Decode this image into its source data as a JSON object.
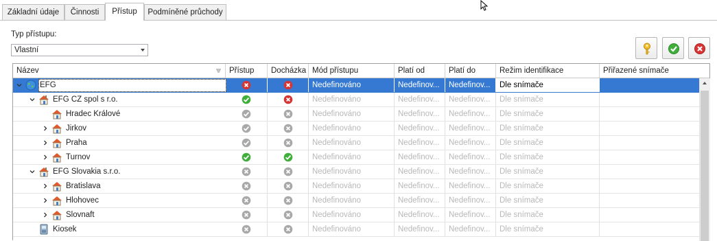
{
  "tabs": [
    {
      "label": "Základní údaje",
      "active": false
    },
    {
      "label": "Činnosti",
      "active": false
    },
    {
      "label": "Přístup",
      "active": true
    },
    {
      "label": "Podmíněné průchody",
      "active": false
    }
  ],
  "access_type": {
    "label": "Typ přístupu:",
    "value": "Vlastní"
  },
  "toolbar": {
    "buttons": [
      "key-icon",
      "confirm-icon",
      "cancel-icon"
    ]
  },
  "columns": [
    "Název",
    "Přístup",
    "Docházka",
    "Mód přístupu",
    "Platí od",
    "Platí do",
    "Režim identifikace",
    "Přiřazené snímače"
  ],
  "rows": [
    {
      "name": "EFG",
      "expand": "open",
      "icon": "globe-icon",
      "access": "denied",
      "attendance": "denied",
      "mode": "Nedefinováno",
      "from": "Nedefinov...",
      "to": "Nedefinov...",
      "ident": "Dle snímače",
      "selected": true,
      "dimmed": false
    },
    {
      "name": "EFG CZ spol s r.o.",
      "expand": "open",
      "icon": "company-icon",
      "access": "granted",
      "attendance": "denied",
      "mode": "Nedefinováno",
      "from": "Nedefinov...",
      "to": "Nedefinov...",
      "ident": "Dle snímače",
      "selected": false,
      "dimmed": true
    },
    {
      "name": "Hradec Králové",
      "expand": "none",
      "icon": "branch-icon",
      "access": "granted-gray",
      "attendance": "denied-gray",
      "mode": "Nedefinováno",
      "from": "Nedefinov...",
      "to": "Nedefinov...",
      "ident": "Dle snímače",
      "selected": false,
      "dimmed": true
    },
    {
      "name": "Jirkov",
      "expand": "closed",
      "icon": "branch-icon",
      "access": "granted-gray",
      "attendance": "denied-gray",
      "mode": "Nedefinováno",
      "from": "Nedefinov...",
      "to": "Nedefinov...",
      "ident": "Dle snímače",
      "selected": false,
      "dimmed": true
    },
    {
      "name": "Praha",
      "expand": "closed",
      "icon": "branch-icon",
      "access": "granted-gray",
      "attendance": "denied-gray",
      "mode": "Nedefinováno",
      "from": "Nedefinov...",
      "to": "Nedefinov...",
      "ident": "Dle snímače",
      "selected": false,
      "dimmed": true
    },
    {
      "name": "Turnov",
      "expand": "closed",
      "icon": "branch-icon",
      "access": "granted",
      "attendance": "granted",
      "mode": "Nedefinováno",
      "from": "Nedefinov...",
      "to": "Nedefinov...",
      "ident": "Dle snímače",
      "selected": false,
      "dimmed": true
    },
    {
      "name": "EFG Slovakia s.r.o.",
      "expand": "open",
      "icon": "company-icon",
      "access": "denied-gray",
      "attendance": "denied-gray",
      "mode": "Nedefinováno",
      "from": "Nedefinov...",
      "to": "Nedefinov...",
      "ident": "Dle snímače",
      "selected": false,
      "dimmed": true
    },
    {
      "name": "Bratislava",
      "expand": "closed",
      "icon": "branch-icon",
      "access": "denied-gray",
      "attendance": "denied-gray",
      "mode": "Nedefinováno",
      "from": "Nedefinov...",
      "to": "Nedefinov...",
      "ident": "Dle snímače",
      "selected": false,
      "dimmed": true
    },
    {
      "name": "Hlohovec",
      "expand": "closed",
      "icon": "branch-icon",
      "access": "denied-gray",
      "attendance": "denied-gray",
      "mode": "Nedefinováno",
      "from": "Nedefinov...",
      "to": "Nedefinov...",
      "ident": "Dle snímače",
      "selected": false,
      "dimmed": true
    },
    {
      "name": "Slovnaft",
      "expand": "closed",
      "icon": "branch-icon",
      "access": "denied-gray",
      "attendance": "denied-gray",
      "mode": "Nedefinováno",
      "from": "Nedefinov...",
      "to": "Nedefinov...",
      "ident": "Dle snímače",
      "selected": false,
      "dimmed": true
    },
    {
      "name": "Kiosek",
      "expand": "none",
      "icon": "kiosk-icon",
      "access": "denied-gray",
      "attendance": "denied-gray",
      "mode": "Nedefinováno",
      "from": "Nedefinov...",
      "to": "Nedefinov...",
      "ident": "Dle snímače",
      "selected": false,
      "dimmed": true
    }
  ],
  "colors": {
    "selection": "#3579d2",
    "granted": "#3fae3a",
    "denied": "#d83434",
    "neutral": "#a9a9a9"
  }
}
